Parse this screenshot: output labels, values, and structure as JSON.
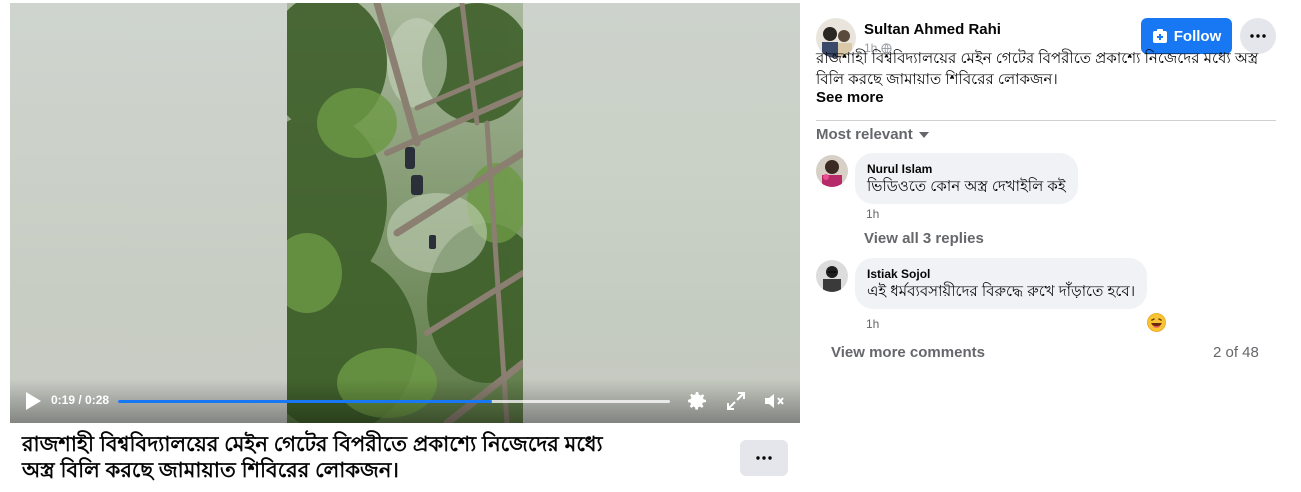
{
  "video": {
    "time_display": "0:19 / 0:28",
    "progress_fraction": 0.678,
    "icons": [
      "play-icon",
      "settings-gear-icon",
      "fullscreen-icon",
      "muted-volume-icon"
    ]
  },
  "caption": {
    "title_line1": "রাজশাহী বিশ্ববিদ্যালয়ের মেইন গেটের বিপরীতে প্রকাশ্যে নিজেদের মধ্যে",
    "title_line2": "অস্ত্র বিলি করছে জামায়াত শিবিরের লোকজন।"
  },
  "post": {
    "author_name": "Sultan Ahmed Rahi",
    "time": "1h",
    "follow_label": "Follow",
    "text": "রাজশাহী বিশ্ববিদ্যালয়ের মেইন গেটের বিপরীতে প্রকাশ্যে নিজেদের মধ্যে অস্ত্র বিলি করছে জামায়াত শিবিরের লোকজন।",
    "see_more": "See more"
  },
  "comments": {
    "sort_label": "Most relevant",
    "items": [
      {
        "name": "Nurul Islam",
        "text": "ভিডিওতে কোন অস্ত্র দেখাইলি কই",
        "time": "1h",
        "replies": "View all 3 replies"
      },
      {
        "name": "Istiak Sojol",
        "text": "এই ধর্মব্যবসায়ীদের বিরুদ্ধে রুখে দাঁড়াতে হবে।",
        "time": "1h",
        "reaction": "laughing-emoji-icon"
      }
    ],
    "view_more": "View more comments",
    "count": "2 of 48"
  },
  "colors": {
    "accent": "#1877f2",
    "bubble": "#f0f2f5",
    "secondary_text": "#65676b"
  }
}
